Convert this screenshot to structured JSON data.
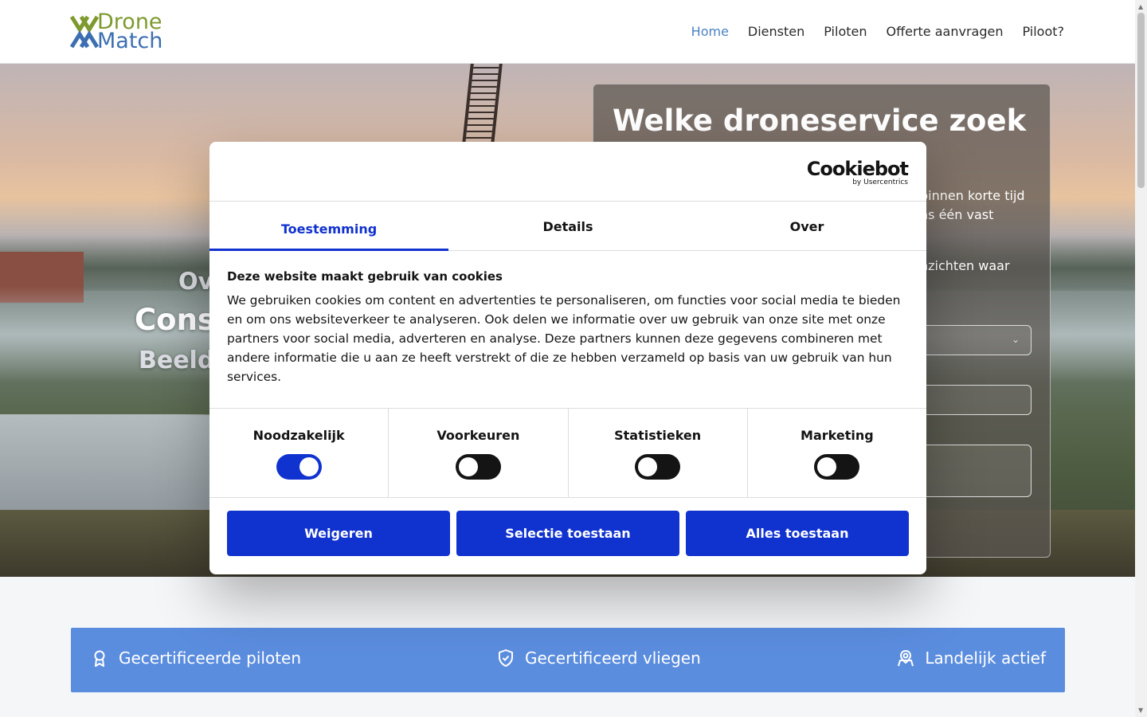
{
  "logo": {
    "line1": "Drone",
    "line2": "Match"
  },
  "nav": [
    {
      "label": "Home",
      "active": true
    },
    {
      "label": "Diensten"
    },
    {
      "label": "Piloten"
    },
    {
      "label": "Offerte aanvragen"
    },
    {
      "label": "Piloot?"
    }
  ],
  "hero": {
    "line1": "Ov",
    "line2": "Cons",
    "line3": "Beeld"
  },
  "service_card": {
    "title": "Welke droneservice zoek jij?",
    "p1": "binnen korte tijd ns één vast",
    "p2": "nzichten waar"
  },
  "features": [
    {
      "label": "Gecertificeerde piloten",
      "icon": "award-icon"
    },
    {
      "label": "Gecertificeerd vliegen",
      "icon": "shield-check-icon"
    },
    {
      "label": "Landelijk actief",
      "icon": "map-pin-user-icon"
    }
  ],
  "cookie": {
    "brand": "Cookiebot",
    "brand_by": "by Usercentrics",
    "tabs": [
      "Toestemming",
      "Details",
      "Over"
    ],
    "heading": "Deze website maakt gebruik van cookies",
    "text": "We gebruiken cookies om content en advertenties te personaliseren, om functies voor social media te bieden en om ons websiteverkeer te analyseren. Ook delen we informatie over uw gebruik van onze site met onze partners voor social media, adverteren en analyse. Deze partners kunnen deze gegevens combineren met andere informatie die u aan ze heeft verstrekt of die ze hebben verzameld op basis van uw gebruik van hun services.",
    "toggles": [
      {
        "label": "Noodzakelijk",
        "on": true
      },
      {
        "label": "Voorkeuren",
        "on": false
      },
      {
        "label": "Statistieken",
        "on": false
      },
      {
        "label": "Marketing",
        "on": false
      }
    ],
    "buttons": [
      "Weigeren",
      "Selectie toestaan",
      "Alles toestaan"
    ]
  },
  "colors": {
    "brand_green": "#7e9a2e",
    "brand_blue": "#3c6fb2",
    "nav_active": "#4a82c4",
    "cookie_blue": "#1032cf",
    "feature_bar": "#5b8ddf"
  }
}
